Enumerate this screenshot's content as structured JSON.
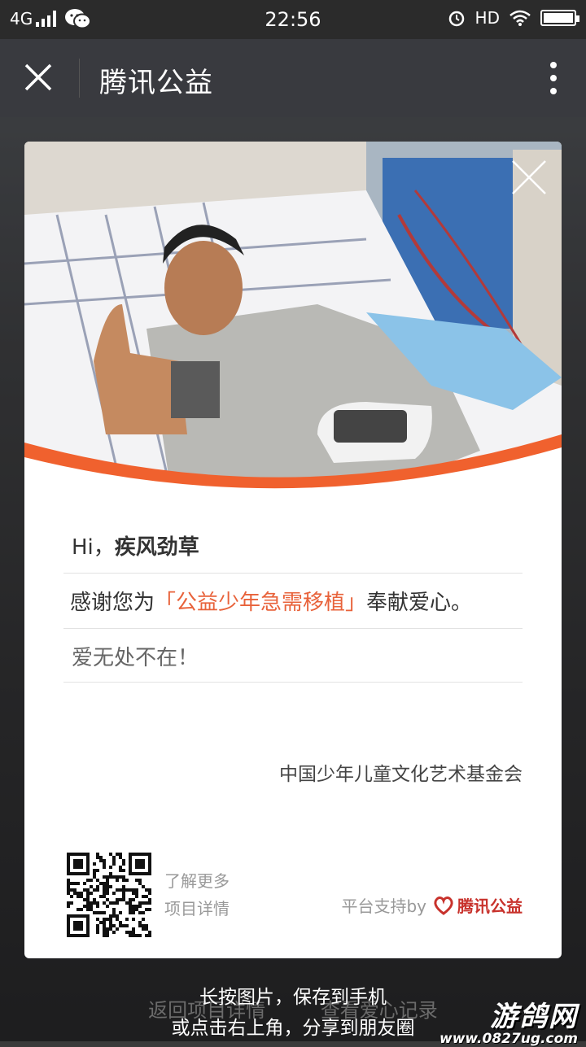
{
  "status_bar": {
    "network": "4G",
    "time": "22:56",
    "hd": "HD"
  },
  "title_bar": {
    "title": "腾讯公益"
  },
  "card": {
    "greeting_prefix": "Hi，",
    "user_name": "疾风劲草",
    "thanks_prefix": "感谢您为",
    "project_name": "「公益少年急需移植」",
    "thanks_suffix": "奉献爱心。",
    "love_text": "爱无处不在！",
    "organization": "中国少年儿童文化艺术基金会",
    "learn_more": "了解更多",
    "project_details": "项目详情",
    "platform_support": "平台支持by",
    "brand": "腾讯公益"
  },
  "background": {
    "back_link": "返回项目详情",
    "records_link": "查看爱心记录"
  },
  "hints": {
    "line1": "长按图片，保存到手机",
    "line2": "或点击右上角，分享到朋友圈"
  },
  "watermark": {
    "title": "游鸽网",
    "url": "www.0827ug.com"
  },
  "colors": {
    "accent": "#e8623a",
    "brand_red": "#c8322c",
    "titlebar": "#393a3f"
  }
}
